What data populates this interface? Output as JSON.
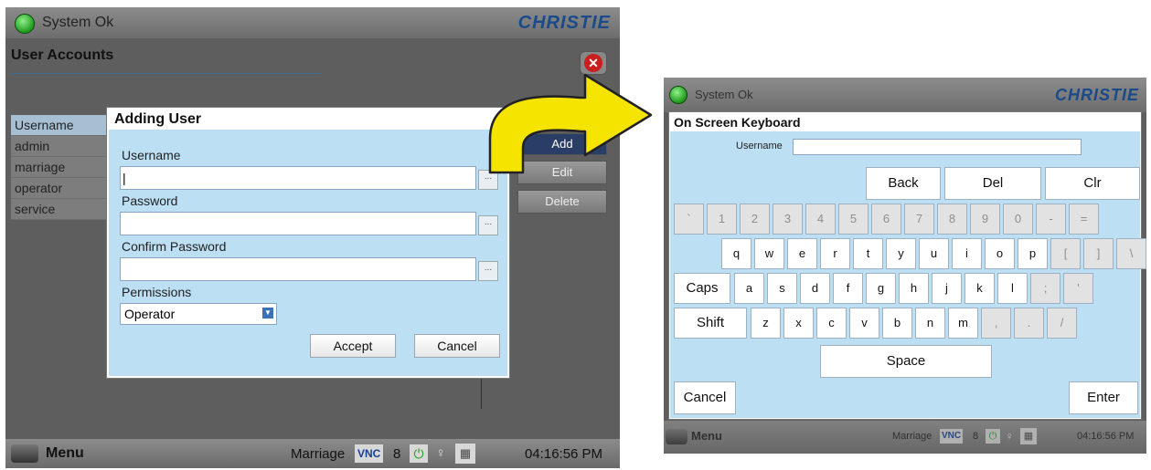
{
  "left": {
    "status": "System Ok",
    "logo": "CHRISTIE",
    "page_title": "User Accounts",
    "user_list": {
      "header": "Username",
      "items": [
        "admin",
        "marriage",
        "operator",
        "service"
      ]
    },
    "side_buttons": {
      "add": "Add",
      "edit": "Edit",
      "delete": "Delete"
    },
    "dialog": {
      "title": "Adding User",
      "username_label": "Username",
      "username_value": "|",
      "password_label": "Password",
      "confirm_label": "Confirm Password",
      "permissions_label": "Permissions",
      "permissions_value": "Operator",
      "dots": "...",
      "accept": "Accept",
      "cancel": "Cancel"
    },
    "bottom": {
      "menu": "Menu",
      "user": "Marriage",
      "vnc": "VNC",
      "count": "8",
      "time": "04:16:56 PM"
    }
  },
  "right": {
    "status": "System Ok",
    "logo": "CHRISTIE",
    "title": "On Screen Keyboard",
    "field_label": "Username",
    "field_value": "",
    "controls": {
      "back": "Back",
      "del": "Del",
      "clr": "Clr"
    },
    "row1": [
      "`",
      "1",
      "2",
      "3",
      "4",
      "5",
      "6",
      "7",
      "8",
      "9",
      "0",
      "-",
      "="
    ],
    "row2": [
      "q",
      "w",
      "e",
      "r",
      "t",
      "y",
      "u",
      "i",
      "o",
      "p",
      "[",
      "]",
      "\\"
    ],
    "row3": [
      "a",
      "s",
      "d",
      "f",
      "g",
      "h",
      "j",
      "k",
      "l",
      ";",
      "'"
    ],
    "row4": [
      "z",
      "x",
      "c",
      "v",
      "b",
      "n",
      "m",
      ",",
      ".",
      "/"
    ],
    "caps": "Caps",
    "shift": "Shift",
    "space": "Space",
    "cancel": "Cancel",
    "enter": "Enter",
    "bottom": {
      "menu": "Menu",
      "user": "Marriage",
      "vnc": "VNC",
      "count": "8",
      "time": "04:16:56 PM"
    }
  },
  "colors": {
    "arrow": "#f5e400",
    "dialog_bg": "#bddff4",
    "status_led": "#2fb52a",
    "logo": "#1a4a8a"
  }
}
